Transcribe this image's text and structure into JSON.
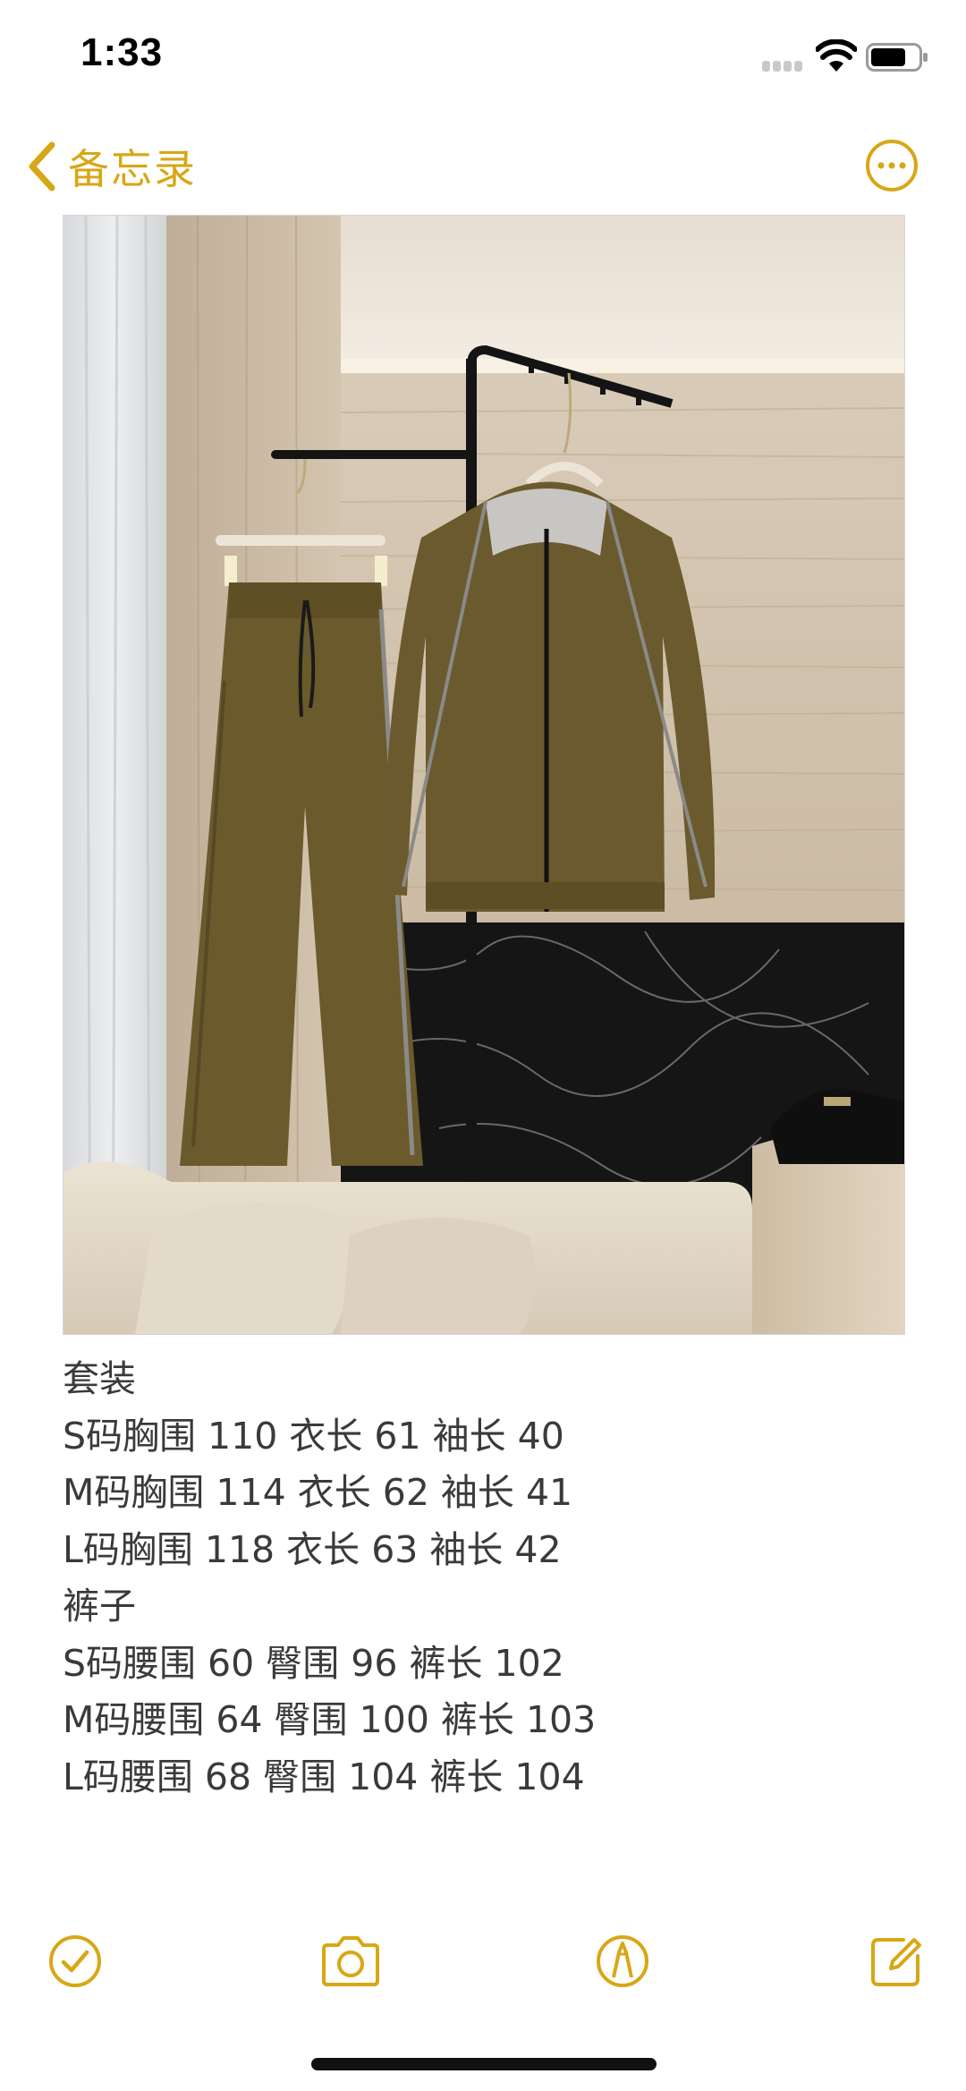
{
  "status_bar": {
    "time": "1:33"
  },
  "nav": {
    "back_label": "备忘录",
    "accent_color": "#D8A716"
  },
  "note": {
    "photo_description_icon": "clothing-photo",
    "lines": [
      "套装",
      "S码胸围 110 衣长 61 袖长 40",
      "M码胸围 114 衣长 62 袖长 41",
      "L码胸围 118 衣长 63 袖长 42",
      "裤子",
      "S码腰围 60 臀围 96 裤长 102",
      "M码腰围 64 臀围 100 裤长 103",
      "L码腰围 68 臀围 104 裤长 104"
    ]
  },
  "toolbar": {
    "icons": [
      "checklist-icon",
      "camera-icon",
      "markup-icon",
      "compose-icon"
    ]
  }
}
